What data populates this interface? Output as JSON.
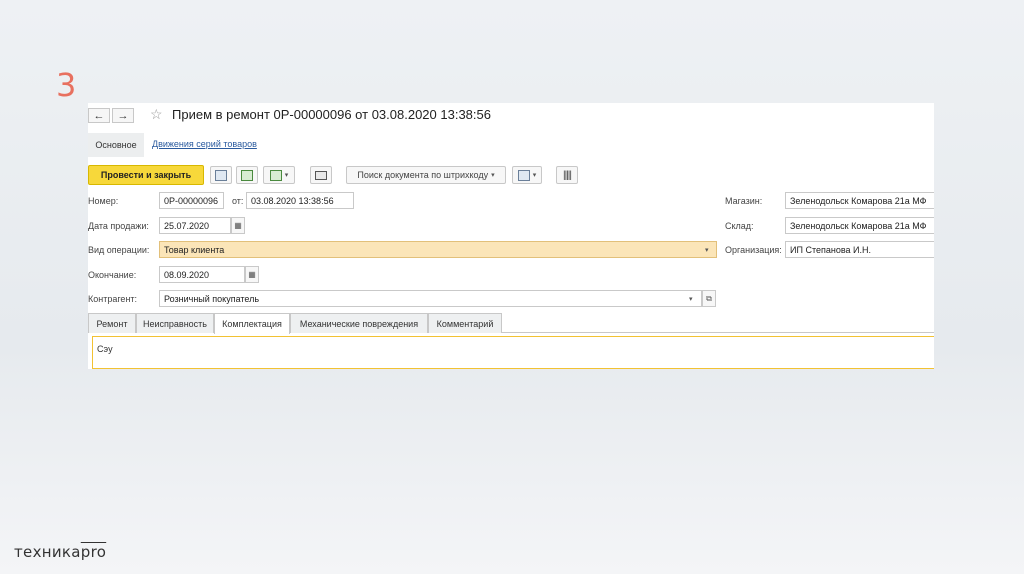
{
  "slide": {
    "number": "3",
    "logo_main": "техника",
    "logo_over": "pro"
  },
  "window": {
    "back": "←",
    "forward": "→",
    "star": "☆",
    "title": "Прием в ремонт 0Р-00000096 от 03.08.2020 13:38:56"
  },
  "subtabs": {
    "main": "Основное",
    "link": "Движения серий товаров"
  },
  "toolbar": {
    "post_close": "Провести и закрыть",
    "search_barcode": "Поиск документа по штрихкоду",
    "caret": "▾"
  },
  "form": {
    "number_label": "Номер:",
    "number_value": "0Р-00000096",
    "from_label": "от:",
    "from_value": "03.08.2020 13:38:56",
    "sale_date_label": "Дата продажи:",
    "sale_date_value": "25.07.2020",
    "op_type_label": "Вид операции:",
    "op_type_value": "Товар клиента",
    "end_label": "Окончание:",
    "end_value": "08.09.2020",
    "contractor_label": "Контрагент:",
    "contractor_value": "Розничный покупатель",
    "store_label": "Магазин:",
    "store_value": "Зеленодольск Комарова 21а МФ",
    "warehouse_label": "Склад:",
    "warehouse_value": "Зеленодольск Комарова 21а МФ",
    "org_label": "Организация:",
    "org_value": "ИП Степанова И.Н."
  },
  "tabs": [
    "Ремонт",
    "Неисправность",
    "Комплектация",
    "Механические повреждения",
    "Комментарий"
  ],
  "active_tab": "Комплектация",
  "memo_text": "Сэу",
  "colors": {
    "accent": "#f7d83a",
    "highlight": "#fbe5b8",
    "slide_number": "#e8705f",
    "link": "#2a5a9e"
  }
}
